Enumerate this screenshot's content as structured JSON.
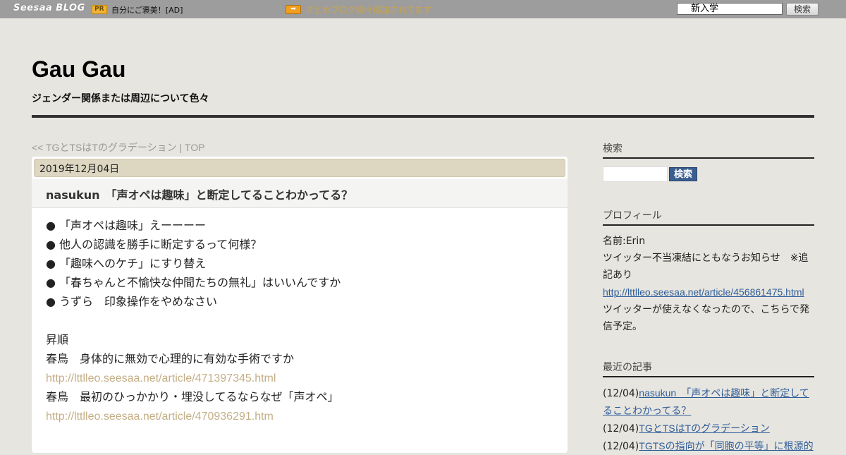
{
  "topbar": {
    "logo": "Seesaa BLOG",
    "pr_badge": "PR",
    "pr_text": "自分にご褒美！[AD]",
    "promo_text": "まとめブログ続々追加されてます",
    "search_value": "新入学",
    "search_button": "検索"
  },
  "header": {
    "title": "Gau Gau",
    "description": "ジェンダー関係または周辺について色々"
  },
  "nav": {
    "prev": "<< TGとTSはTのグラデーション",
    "separator": " | ",
    "top": "TOP"
  },
  "post": {
    "date": "2019年12月04日",
    "title": "nasukun　「声オペは趣味」と断定してることわかってる？",
    "bullets": [
      "● 「声オペは趣味」えーーーー",
      "● 他人の認識を勝手に断定するって何様？",
      "● 「趣味へのケチ」にすり替え",
      "● 「春ちゃんと不愉快な仲間たちの無礼」はいいんですか",
      "● うずら　印象操作をやめなさい"
    ],
    "order_label": "昇順",
    "refs": [
      {
        "text": "春鳥　身体的に無効で心理的に有効な手術ですか",
        "url": "http://lttlleo.seesaa.net/article/471397345.html"
      },
      {
        "text": "春鳥　最初のひっかかり・埋没してるならなぜ「声オペ」",
        "url": "http://lttlleo.seesaa.net/article/470936291.htm"
      }
    ]
  },
  "sidebar": {
    "search": {
      "heading": "検索",
      "button": "検索"
    },
    "profile": {
      "heading": "プロフィール",
      "name": "名前:Erin",
      "notice": "ツイッター不当凍結にともなうお知らせ　※追記あり",
      "link": "http://lttlleo.seesaa.net/article/456861475.html",
      "note": "ツイッターが使えなくなったので、こちらで発信予定。"
    },
    "recent": {
      "heading": "最近の記事",
      "items": [
        {
          "date": "(12/04)",
          "title": "nasukun　「声オペは趣味」と断定してることわかってる？"
        },
        {
          "date": "(12/04)",
          "title": "TGとTSはTのグラデーション"
        },
        {
          "date": "(12/04)",
          "title": "TGTSの指向が「同胞の平等」に根源的"
        }
      ]
    }
  },
  "colors": {
    "background": "#e7e5df",
    "topbar": "#9d9d9d",
    "date_bar": "#ddd7c2",
    "link_tan": "#c4ae85",
    "link_blue": "#2f5d9a",
    "search_button": "#3a5e8e"
  }
}
